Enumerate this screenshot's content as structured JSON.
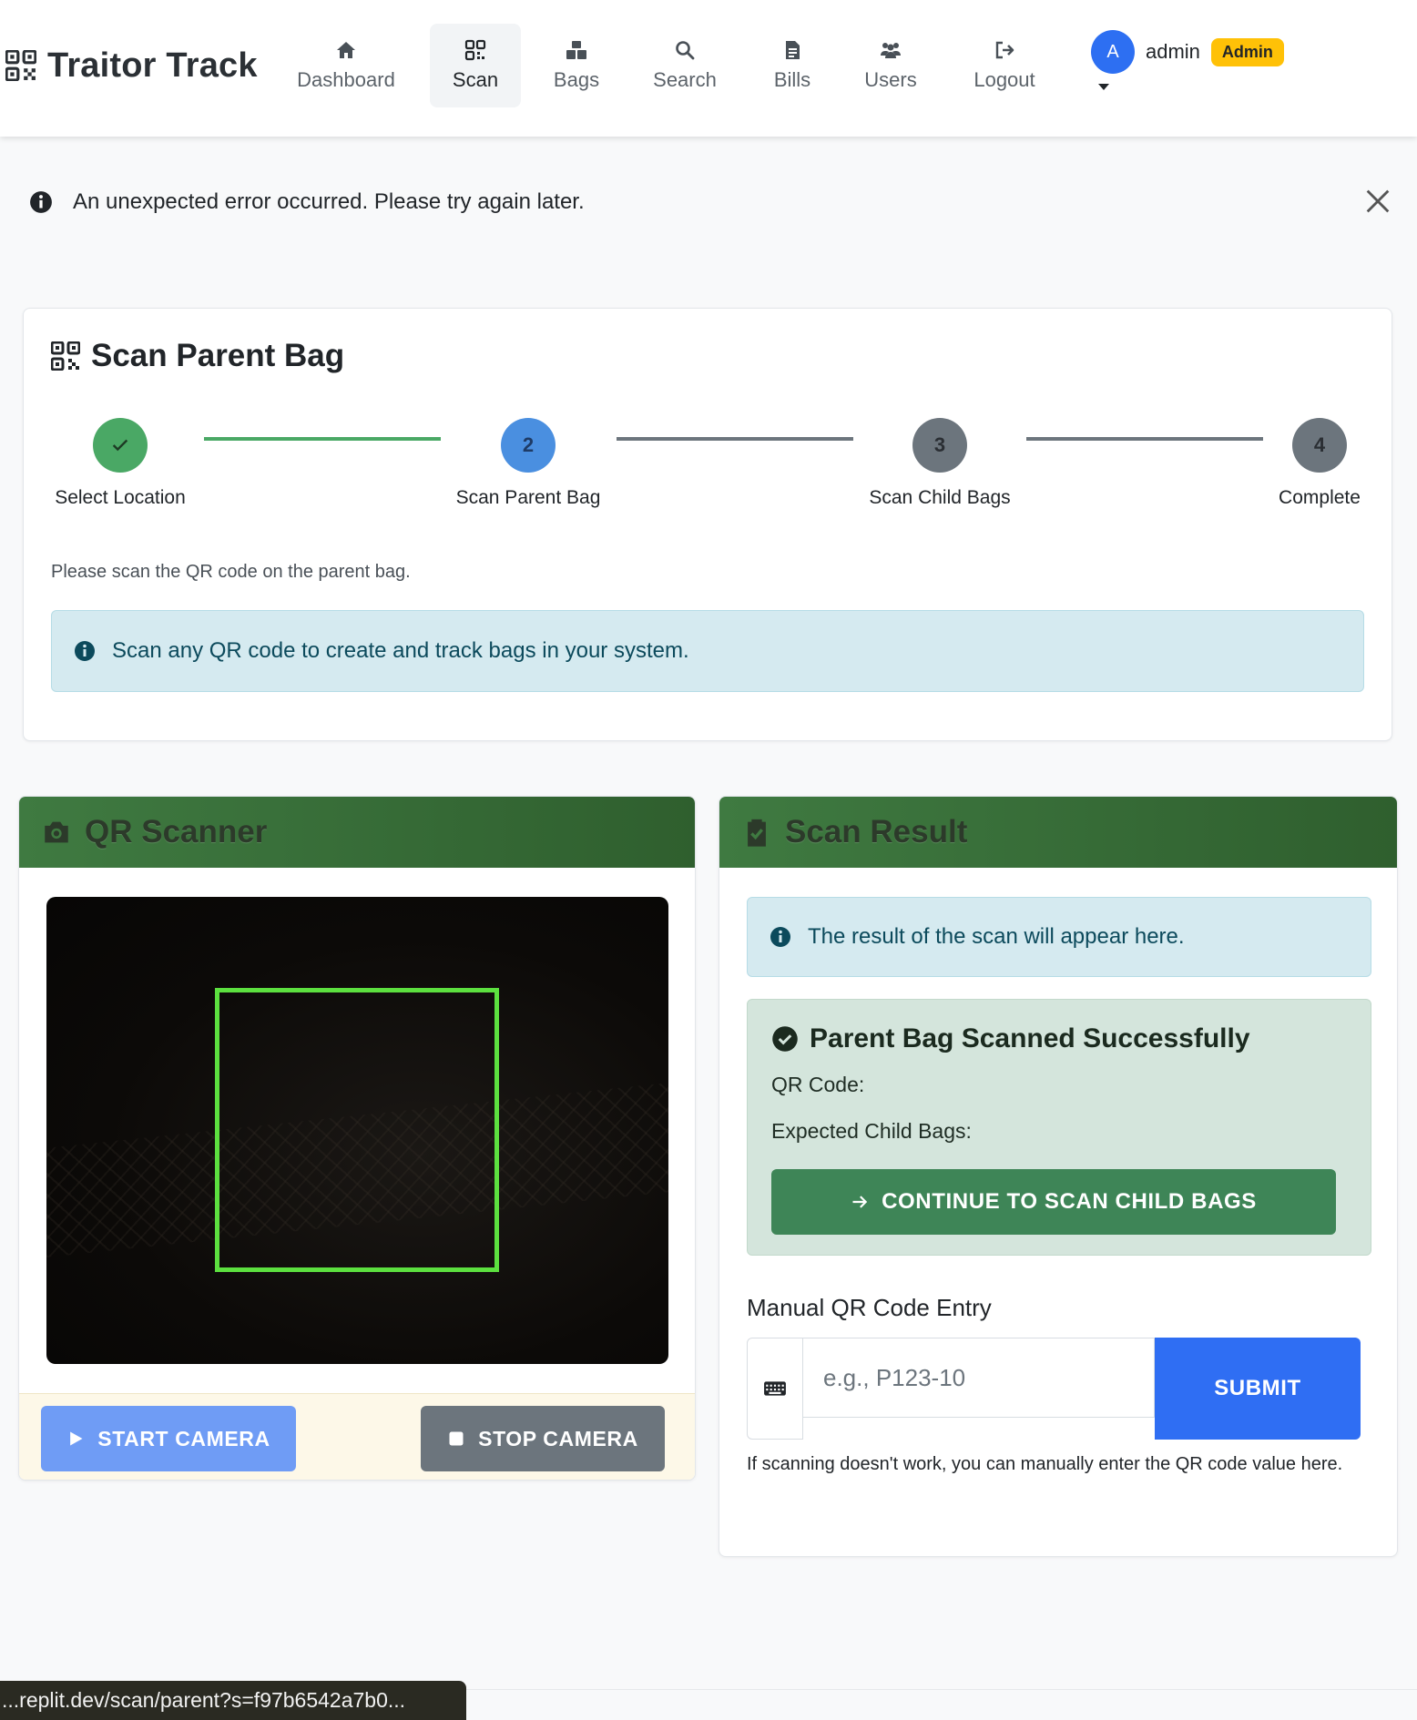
{
  "brand": {
    "name": "Traitor Track",
    "icon": "qrcode-icon"
  },
  "nav": {
    "items": [
      {
        "label": "Dashboard",
        "icon": "home-icon"
      },
      {
        "label": "Scan",
        "icon": "qrcode-icon",
        "active": true
      },
      {
        "label": "Bags",
        "icon": "boxes-icon"
      },
      {
        "label": "Search",
        "icon": "search-icon"
      },
      {
        "label": "Bills",
        "icon": "file-invoice-icon"
      },
      {
        "label": "Users",
        "icon": "users-icon"
      },
      {
        "label": "Logout",
        "icon": "sign-out-icon"
      }
    ],
    "user": {
      "avatar_initial": "A",
      "name": "admin",
      "role": "Admin"
    }
  },
  "alert": {
    "message": "An unexpected error occurred. Please try again later.",
    "icon": "info-circle-icon"
  },
  "steps_card": {
    "title": "Scan Parent Bag",
    "steps": [
      {
        "number": "",
        "label": "Select Location",
        "state": "completed"
      },
      {
        "number": "2",
        "label": "Scan Parent Bag",
        "state": "active"
      },
      {
        "number": "3",
        "label": "Scan Child Bags",
        "state": "pending"
      },
      {
        "number": "4",
        "label": "Complete",
        "state": "pending"
      }
    ],
    "description": "Please scan the QR code on the parent bag.",
    "info": "Scan any QR code to create and track bags in your system."
  },
  "scanner": {
    "title": "QR Scanner",
    "start_label": "START CAMERA",
    "stop_label": "STOP CAMERA"
  },
  "result": {
    "title": "Scan Result",
    "info": "The result of the scan will appear here.",
    "success_title": "Parent Bag Scanned Successfully",
    "qr_code_label": "QR Code:",
    "expected_children_label": "Expected Child Bags:",
    "continue_label": "CONTINUE TO SCAN CHILD BAGS",
    "manual_title": "Manual QR Code Entry",
    "input_placeholder": "e.g., P123-10",
    "input_value": "",
    "submit_label": "SUBMIT",
    "help_text": "If scanning doesn't work, you can manually enter the QR code value here."
  },
  "status_bar": {
    "url": "...replit.dev/scan/parent?s=f97b6542a7b0..."
  },
  "colors": {
    "primary": "#2f6ef3",
    "success": "#3e8557",
    "step_done": "#4aa865",
    "step_active": "#4a8fe0",
    "step_pending": "#6c757d",
    "header_green": "#3f7a41",
    "badge_warning": "#ffc107"
  }
}
